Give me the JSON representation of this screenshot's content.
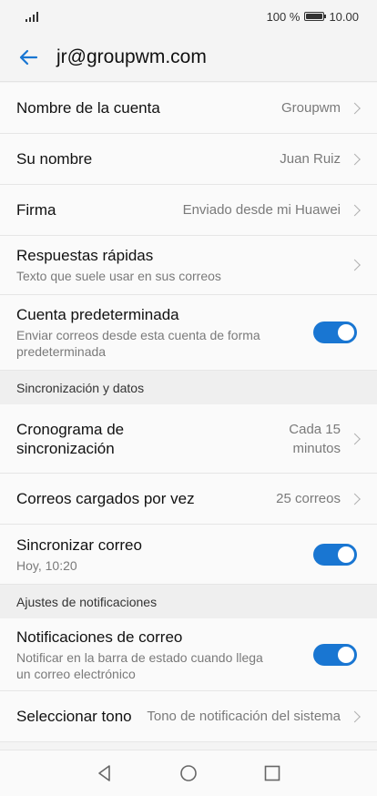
{
  "status_bar": {
    "battery_percent": "100 %",
    "time": "10.00",
    "battery_level": 1.0
  },
  "header": {
    "title": "jr@groupwm.com"
  },
  "settings": {
    "account_name": {
      "label": "Nombre de la cuenta",
      "value": "Groupwm"
    },
    "your_name": {
      "label": "Su nombre",
      "value": "Juan Ruiz"
    },
    "signature": {
      "label": "Firma",
      "value": "Enviado desde mi Huawei"
    },
    "quick_replies": {
      "label": "Respuestas rápidas",
      "sub": "Texto que suele usar en sus correos"
    },
    "default_account": {
      "label": "Cuenta predeterminada",
      "sub_line1": "Enviar correos desde esta cuenta de forma",
      "sub_line2": "predeterminada",
      "enabled": true
    }
  },
  "sync_section": {
    "title": "Sincronización y datos",
    "schedule": {
      "label_line1": "Cronograma de",
      "label_line2": "sincronización",
      "value_line1": "Cada 15",
      "value_line2": "minutos"
    },
    "emails_per_load": {
      "label": "Correos cargados por vez",
      "value": "25 correos"
    },
    "sync_mail": {
      "label": "Sincronizar correo",
      "sub": "Hoy, 10:20",
      "enabled": true
    }
  },
  "notification_section": {
    "title": "Ajustes de notificaciones",
    "mail_notifications": {
      "label": "Notificaciones de correo",
      "sub_line1": "Notificar en la barra de estado cuando llega",
      "sub_line2": "un correo electrónico",
      "enabled": true
    },
    "ringtone": {
      "label": "Seleccionar tono",
      "value": "Tono de notificación del sistema"
    }
  },
  "icons": {
    "back": "arrow-left-icon",
    "nav_back": "triangle-back-icon",
    "nav_home": "circle-home-icon",
    "nav_recents": "square-recents-icon"
  },
  "colors": {
    "accent": "#1976d2"
  }
}
